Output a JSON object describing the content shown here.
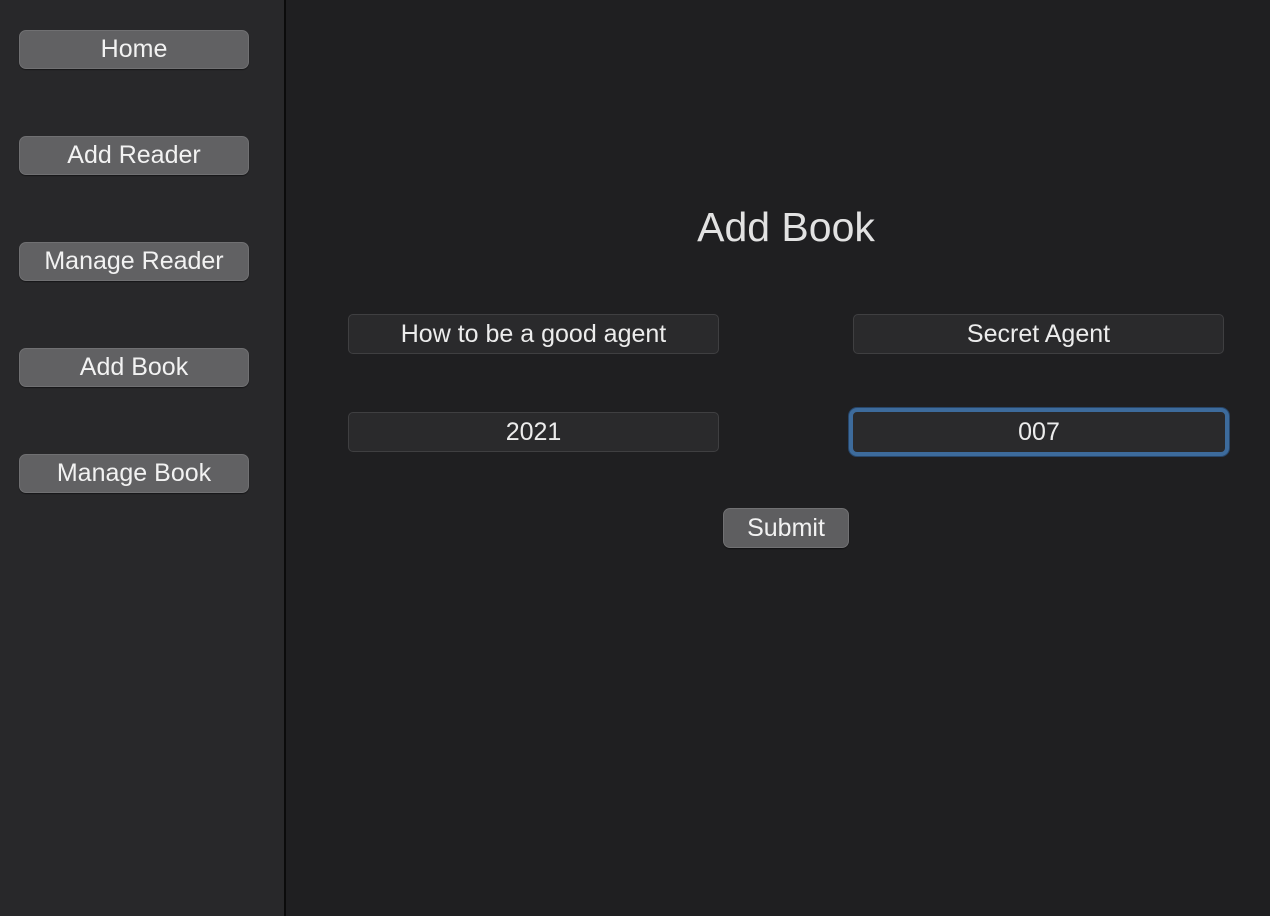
{
  "sidebar": {
    "items": [
      {
        "label": "Home"
      },
      {
        "label": "Add Reader"
      },
      {
        "label": "Manage Reader"
      },
      {
        "label": "Add Book"
      },
      {
        "label": "Manage Book"
      }
    ]
  },
  "main": {
    "title": "Add Book",
    "fields": {
      "book_title": {
        "value": "How to be a good agent"
      },
      "author": {
        "value": "Secret Agent"
      },
      "year": {
        "value": "2021"
      },
      "code": {
        "value": "007"
      }
    },
    "submit_label": "Submit"
  },
  "colors": {
    "background": "#1f1f21",
    "sidebar": "#28282a",
    "button": "#616163",
    "field": "#2a2a2c",
    "focus_ring": "#3d6b9c"
  }
}
